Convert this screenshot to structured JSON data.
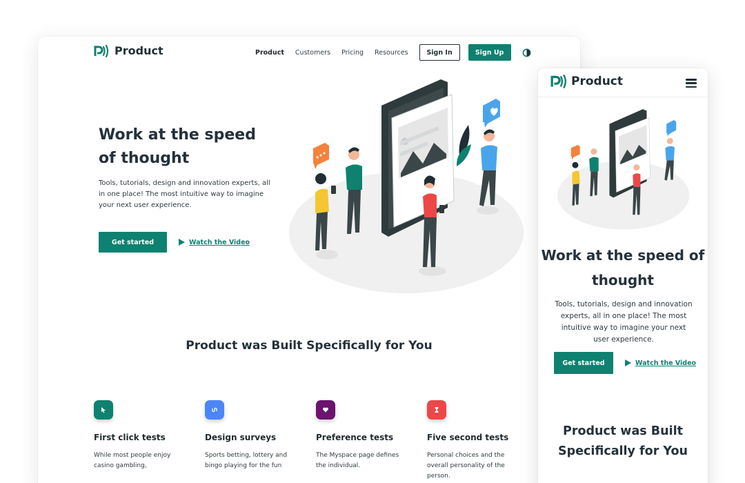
{
  "brand": {
    "name": "Product",
    "green": "#0e8170",
    "dark": "#1f2f34"
  },
  "desktop": {
    "nav": {
      "items": [
        "Product",
        "Customers",
        "Pricing",
        "Resources"
      ],
      "active": "Product",
      "sign_in": "Sign In",
      "sign_up": "Sign Up",
      "theme_icon": "contrast-icon"
    },
    "hero": {
      "title": "Work at the speed of thought",
      "subtitle": "Tools, tutorials, design and innovation experts, all in one place! The most intuitive way to imagine your next user experience.",
      "cta_primary": "Get started",
      "cta_secondary": "Watch the Video"
    },
    "built": {
      "title": "Product  was Built Specifically for You"
    },
    "features": [
      {
        "title": "First click tests",
        "text": "While most people enjoy casino gambling,",
        "color": "#0e8170",
        "icon": "cursor-icon"
      },
      {
        "title": "Design surveys",
        "text": "Sports betting, lottery and bingo playing for the fun",
        "color": "#4a86f7",
        "icon": "survey-icon"
      },
      {
        "title": "Preference tests",
        "text": "The Myspace page defines the individual.",
        "color": "#6c1470",
        "icon": "heart-icon"
      },
      {
        "title": "Five second tests",
        "text": "Personal choices and the overall personality of the person.",
        "color": "#ee4747",
        "icon": "hourglass-icon"
      }
    ]
  },
  "mobile": {
    "menu_icon": "hamburger-icon",
    "hero": {
      "title": "Work at the speed of thought",
      "subtitle": "Tools, tutorials, design and innovation experts, all in one place! The most intuitive way to imagine your next user experience.",
      "cta_primary": "Get started",
      "cta_secondary": "Watch the Video"
    },
    "built": {
      "title": "Product  was Built Specifically for You"
    }
  }
}
